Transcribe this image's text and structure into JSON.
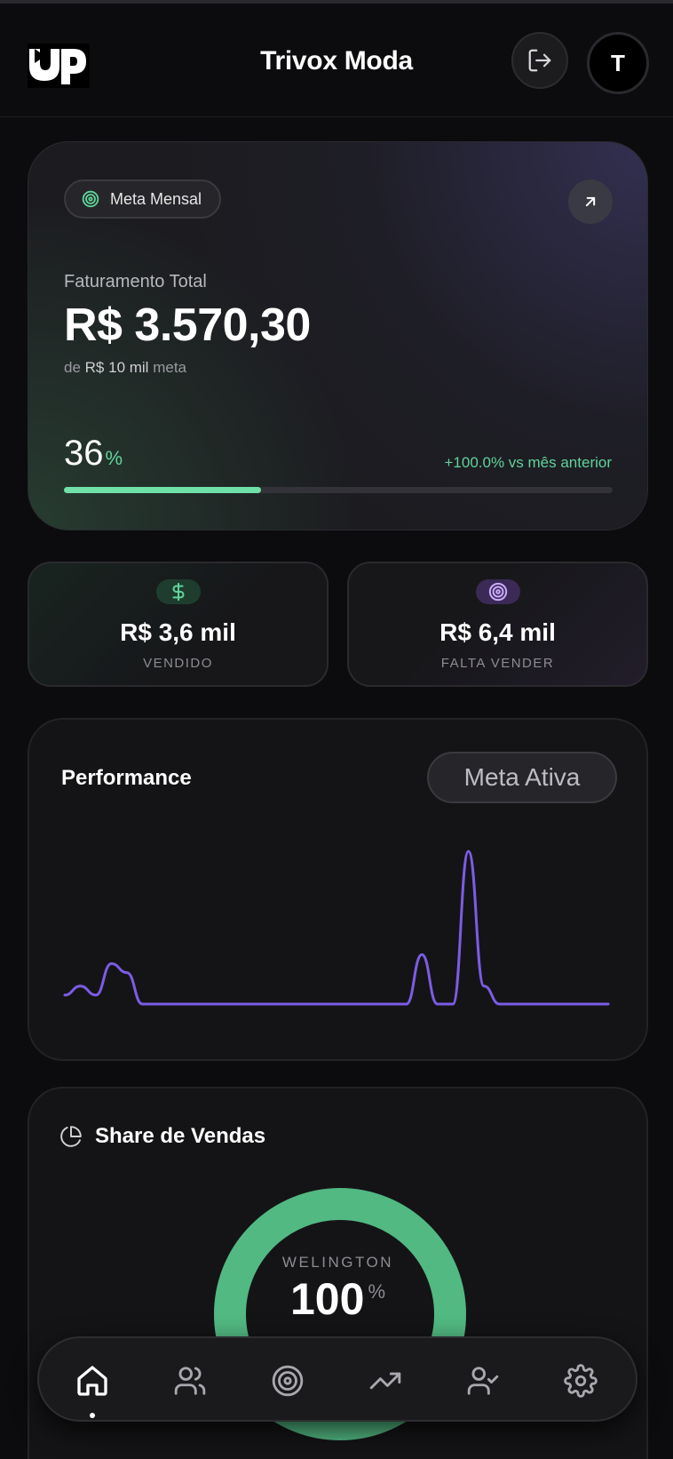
{
  "header": {
    "title": "Trivox Moda",
    "logo_alt": "UP",
    "avatar_initial": "T"
  },
  "goal": {
    "chip_label": "Meta Mensal",
    "total_label": "Faturamento Total",
    "total_value": "R$ 3.570,30",
    "sub_prefix": "de",
    "sub_goal": "R$ 10 mil",
    "sub_suffix": "meta",
    "percent": "36",
    "percent_symbol": "%",
    "progress": 0.36,
    "growth": "+100.0% vs mês anterior"
  },
  "stats": {
    "sold_value": "R$ 3,6 mil",
    "sold_label": "VENDIDO",
    "remaining_value": "R$ 6,4 mil",
    "remaining_label": "FALTA VENDER"
  },
  "performance": {
    "title": "Performance",
    "filter_label": "Meta Ativa"
  },
  "chart_data": {
    "type": "line",
    "title": "",
    "xlabel": "",
    "ylabel": "",
    "grid": false,
    "legend": "none",
    "series": [
      {
        "color": "#7c5ce6",
        "values": [
          2,
          4,
          2,
          9,
          7,
          0,
          0,
          0,
          0,
          0,
          0,
          0,
          0,
          0,
          0,
          0,
          0,
          0,
          0,
          0,
          0,
          0,
          0,
          11,
          0,
          0,
          34,
          4,
          0,
          0,
          0,
          0,
          0,
          0,
          0,
          0
        ]
      }
    ],
    "ylim": [
      0,
      36
    ]
  },
  "share": {
    "title": "Share de Vendas",
    "seller_name": "WELINGTON",
    "seller_percent": "100",
    "percent_symbol": "%",
    "donut_fraction": 1.0
  },
  "colors": {
    "accent_green": "#5fd49a",
    "accent_purple": "#7c5ce6",
    "donut_green": "#52b983"
  },
  "nav": {
    "items": [
      "home-icon",
      "users-icon",
      "target-icon",
      "trending-up-icon",
      "user-check-icon",
      "gear-icon"
    ],
    "active": 0
  }
}
